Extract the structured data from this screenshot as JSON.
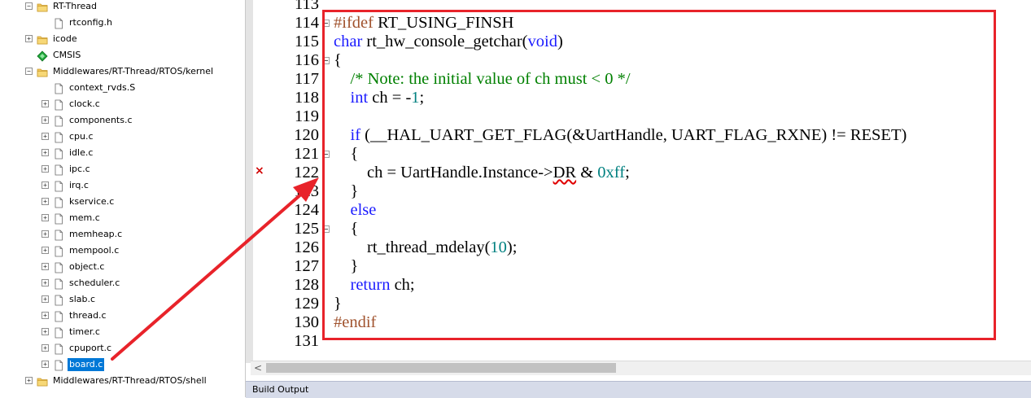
{
  "project_tree": {
    "items": [
      {
        "label": "RT-Thread",
        "icon": "folder-icon",
        "expander": "minus"
      },
      {
        "label": "rtconfig.h",
        "icon": "file-icon",
        "expander": "none"
      },
      {
        "label": "icode",
        "icon": "folder-icon",
        "expander": "plus"
      },
      {
        "label": "CMSIS",
        "icon": "component-icon",
        "expander": "none"
      },
      {
        "label": "Middlewares/RT-Thread/RTOS/kernel",
        "icon": "folder-icon",
        "expander": "minus"
      },
      {
        "label": "context_rvds.S",
        "icon": "file-icon",
        "expander": "none"
      },
      {
        "label": "clock.c",
        "icon": "file-icon",
        "expander": "plus"
      },
      {
        "label": "components.c",
        "icon": "file-icon",
        "expander": "plus"
      },
      {
        "label": "cpu.c",
        "icon": "file-icon",
        "expander": "plus"
      },
      {
        "label": "idle.c",
        "icon": "file-icon",
        "expander": "plus"
      },
      {
        "label": "ipc.c",
        "icon": "file-icon",
        "expander": "plus"
      },
      {
        "label": "irq.c",
        "icon": "file-icon",
        "expander": "plus"
      },
      {
        "label": "kservice.c",
        "icon": "file-icon",
        "expander": "plus"
      },
      {
        "label": "mem.c",
        "icon": "file-icon",
        "expander": "plus"
      },
      {
        "label": "memheap.c",
        "icon": "file-icon",
        "expander": "plus"
      },
      {
        "label": "mempool.c",
        "icon": "file-icon",
        "expander": "plus"
      },
      {
        "label": "object.c",
        "icon": "file-icon",
        "expander": "plus"
      },
      {
        "label": "scheduler.c",
        "icon": "file-icon",
        "expander": "plus"
      },
      {
        "label": "slab.c",
        "icon": "file-icon",
        "expander": "plus"
      },
      {
        "label": "thread.c",
        "icon": "file-icon",
        "expander": "plus"
      },
      {
        "label": "timer.c",
        "icon": "file-icon",
        "expander": "plus"
      },
      {
        "label": "cpuport.c",
        "icon": "file-icon",
        "expander": "plus"
      },
      {
        "label": "board.c",
        "icon": "file-icon",
        "expander": "plus",
        "selected": true
      },
      {
        "label": "Middlewares/RT-Thread/RTOS/shell",
        "icon": "folder-icon",
        "expander": "plus"
      }
    ]
  },
  "editor": {
    "lines": [
      {
        "num": "113",
        "fold": false,
        "segments": []
      },
      {
        "num": "114",
        "fold": true,
        "segments": [
          {
            "t": "#ifdef",
            "c": "pp"
          },
          {
            "t": " RT_USING_FINSH",
            "c": ""
          }
        ]
      },
      {
        "num": "115",
        "fold": false,
        "segments": [
          {
            "t": "char",
            "c": "kw"
          },
          {
            "t": " rt_hw_console_getchar(",
            "c": ""
          },
          {
            "t": "void",
            "c": "kw"
          },
          {
            "t": ")",
            "c": ""
          }
        ]
      },
      {
        "num": "116",
        "fold": true,
        "segments": [
          {
            "t": "{",
            "c": ""
          }
        ]
      },
      {
        "num": "117",
        "fold": false,
        "segments": [
          {
            "t": "    /* Note: the initial value of ch must < 0 */",
            "c": "cm"
          }
        ]
      },
      {
        "num": "118",
        "fold": false,
        "segments": [
          {
            "t": "    ",
            "c": ""
          },
          {
            "t": "int",
            "c": "kw"
          },
          {
            "t": " ch = -",
            "c": ""
          },
          {
            "t": "1",
            "c": "num"
          },
          {
            "t": ";",
            "c": ""
          }
        ]
      },
      {
        "num": "119",
        "fold": false,
        "segments": []
      },
      {
        "num": "120",
        "fold": false,
        "segments": [
          {
            "t": "    ",
            "c": ""
          },
          {
            "t": "if",
            "c": "kw"
          },
          {
            "t": " (__HAL_UART_GET_FLAG(&UartHandle, UART_FLAG_RXNE) != RESET)",
            "c": ""
          }
        ]
      },
      {
        "num": "121",
        "fold": true,
        "segments": [
          {
            "t": "    {",
            "c": ""
          }
        ]
      },
      {
        "num": "122",
        "fold": false,
        "segments": [
          {
            "t": "        ch = UartHandle.Instance->",
            "c": ""
          },
          {
            "t": "DR",
            "c": "squig"
          },
          {
            "t": " & ",
            "c": ""
          },
          {
            "t": "0xff",
            "c": "num"
          },
          {
            "t": ";",
            "c": ""
          }
        ]
      },
      {
        "num": "123",
        "fold": false,
        "segments": [
          {
            "t": "    }",
            "c": ""
          }
        ]
      },
      {
        "num": "124",
        "fold": false,
        "segments": [
          {
            "t": "    ",
            "c": ""
          },
          {
            "t": "else",
            "c": "kw"
          }
        ]
      },
      {
        "num": "125",
        "fold": true,
        "segments": [
          {
            "t": "    {",
            "c": ""
          }
        ]
      },
      {
        "num": "126",
        "fold": false,
        "segments": [
          {
            "t": "        rt_thread_mdelay(",
            "c": ""
          },
          {
            "t": "10",
            "c": "num"
          },
          {
            "t": ");",
            "c": ""
          }
        ]
      },
      {
        "num": "127",
        "fold": false,
        "segments": [
          {
            "t": "    }",
            "c": ""
          }
        ]
      },
      {
        "num": "128",
        "fold": false,
        "segments": [
          {
            "t": "    ",
            "c": ""
          },
          {
            "t": "return",
            "c": "kw"
          },
          {
            "t": " ch;",
            "c": ""
          }
        ]
      },
      {
        "num": "129",
        "fold": false,
        "segments": [
          {
            "t": "}",
            "c": ""
          }
        ]
      },
      {
        "num": "130",
        "fold": false,
        "segments": [
          {
            "t": "#endif",
            "c": "pp"
          }
        ]
      },
      {
        "num": "131",
        "fold": false,
        "segments": []
      }
    ],
    "error_marker": "×",
    "colors": {
      "keyword": "#1c1cff",
      "preprocessor": "#a0522d",
      "comment": "#008000",
      "number": "#008080",
      "annotation": "#e8232a"
    }
  },
  "scrollbar": {
    "left_arrow": "<"
  },
  "build_output": {
    "title": "Build Output"
  }
}
